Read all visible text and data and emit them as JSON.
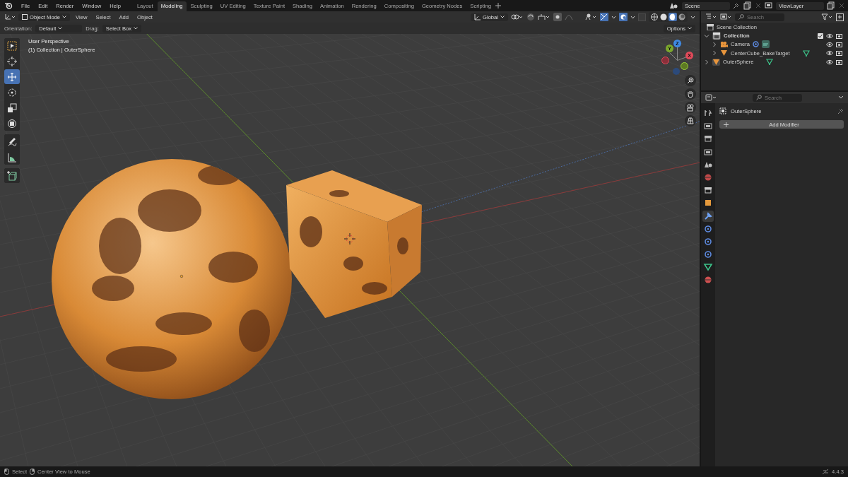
{
  "menu": [
    "File",
    "Edit",
    "Render",
    "Window",
    "Help"
  ],
  "workspaces": [
    {
      "label": "Layout",
      "selected": false
    },
    {
      "label": "Modeling",
      "selected": true
    },
    {
      "label": "Sculpting",
      "selected": false
    },
    {
      "label": "UV Editing",
      "selected": false
    },
    {
      "label": "Texture Paint",
      "selected": false
    },
    {
      "label": "Shading",
      "selected": false
    },
    {
      "label": "Animation",
      "selected": false
    },
    {
      "label": "Rendering",
      "selected": false
    },
    {
      "label": "Compositing",
      "selected": false
    },
    {
      "label": "Geometry Nodes",
      "selected": false
    },
    {
      "label": "Scripting",
      "selected": false
    }
  ],
  "scene": {
    "name": "Scene"
  },
  "view_layer": {
    "name": "ViewLayer"
  },
  "viewport_header": {
    "mode": "Object Mode",
    "menus": [
      "View",
      "Select",
      "Add",
      "Object"
    ],
    "orientation": "Global",
    "shading_modes": [
      {
        "kind": "wireframe",
        "selected": false
      },
      {
        "kind": "solid",
        "selected": false
      },
      {
        "kind": "material",
        "selected": true
      },
      {
        "kind": "rendered",
        "selected": false
      }
    ]
  },
  "tool_settings": {
    "orientation_label": "Orientation:",
    "orientation": "Default",
    "drag_label": "Drag:",
    "drag": "Select Box",
    "options": "Options"
  },
  "viewport": {
    "view_name": "User Perspective",
    "object_info": "(1) Collection | OuterSphere",
    "gizmo_labels": [
      "Z",
      "Y",
      "X"
    ]
  },
  "tool_groups": [
    [
      {
        "kind": "select",
        "selected": false
      },
      {
        "kind": "cursor",
        "selected": false
      },
      {
        "kind": "move",
        "selected": true
      },
      {
        "kind": "rotate",
        "selected": false
      },
      {
        "kind": "scale",
        "selected": false
      },
      {
        "kind": "transform",
        "selected": false
      }
    ],
    [
      {
        "kind": "annotate",
        "selected": false
      },
      {
        "kind": "measure",
        "selected": false
      }
    ],
    [
      {
        "kind": "add-cube",
        "selected": false
      }
    ]
  ],
  "outliner": {
    "search_placeholder": "Search",
    "root": "Scene Collection",
    "items": [
      {
        "name": "Collection",
        "kind": "collection",
        "expanded": true,
        "checked": true,
        "children": [
          {
            "name": "Camera",
            "kind": "camera",
            "expanded": false
          },
          {
            "name": "CenterCube_BakeTarget",
            "kind": "mesh",
            "expanded": false
          }
        ]
      },
      {
        "name": "OuterSphere",
        "kind": "mesh",
        "expanded": false
      }
    ]
  },
  "properties": {
    "search_placeholder": "Search",
    "object_name": "OuterSphere",
    "add_modifier": "Add Modifier",
    "tabs": [
      {
        "kind": "tool",
        "selected": false
      },
      {
        "kind": "render",
        "selected": false
      },
      {
        "kind": "output",
        "selected": false
      },
      {
        "kind": "view-layer",
        "selected": false
      },
      {
        "kind": "scene",
        "selected": false
      },
      {
        "kind": "world",
        "selected": false
      },
      {
        "kind": "collection",
        "selected": false
      },
      {
        "kind": "object",
        "selected": false
      },
      {
        "kind": "modifier",
        "selected": true
      },
      {
        "kind": "particles",
        "selected": false
      },
      {
        "kind": "physics",
        "selected": false
      },
      {
        "kind": "constraints",
        "selected": false
      },
      {
        "kind": "data",
        "selected": false
      },
      {
        "kind": "material",
        "selected": false
      }
    ]
  },
  "status_bar": {
    "hints": [
      "Select",
      "Center View to Mouse"
    ],
    "version": "4.4.3"
  }
}
